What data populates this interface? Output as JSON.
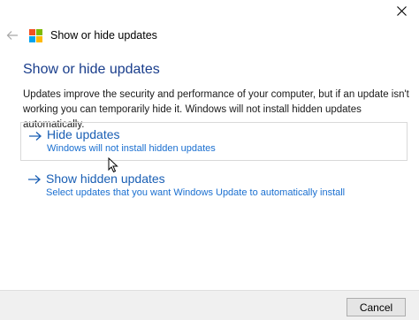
{
  "window": {
    "header_title": "Show or hide updates",
    "close_icon": "close-icon",
    "back_icon": "back-arrow-icon",
    "logo_icon": "windows-logo-icon"
  },
  "main": {
    "title": "Show or hide updates",
    "description": "Updates improve the security and performance of your computer, but if an update isn't working you can temporarily hide it. Windows will not install hidden updates automatically.",
    "options": [
      {
        "title": "Hide updates",
        "subtitle": "Windows will not install hidden updates",
        "icon": "arrow-right-icon"
      },
      {
        "title": "Show hidden updates",
        "subtitle": "Select updates that you want Windows Update to automatically install",
        "icon": "arrow-right-icon"
      }
    ]
  },
  "footer": {
    "cancel_label": "Cancel"
  },
  "colors": {
    "title": "#1a3e8c",
    "link": "#1a5fb4",
    "footer_bg": "#f0f0f0"
  }
}
